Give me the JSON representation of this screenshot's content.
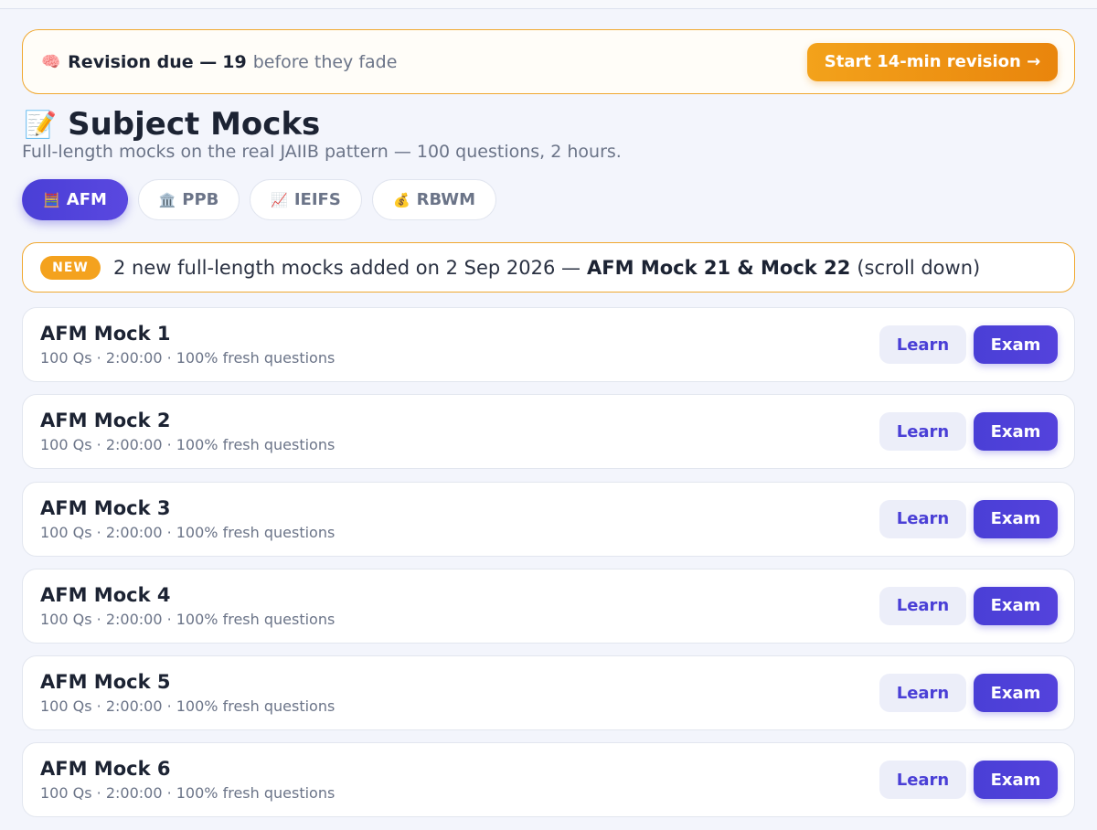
{
  "revision": {
    "label": "Revision due —",
    "count": "19",
    "suffix": "before they fade",
    "button_label": "Start 14-min revision →"
  },
  "page": {
    "title": "Subject Mocks",
    "subtitle": "Full-length mocks on the real JAIIB pattern — 100 questions, 2 hours."
  },
  "tabs": [
    {
      "label": "AFM",
      "icon": "🧮",
      "active": true
    },
    {
      "label": "PPB",
      "icon": "🏛️",
      "active": false
    },
    {
      "label": "IEIFS",
      "icon": "📈",
      "active": false
    },
    {
      "label": "RBWM",
      "icon": "💰",
      "active": false
    }
  ],
  "notice": {
    "badge": "NEW",
    "text": "2 new full-length mocks added on 2 Sep 2026 —",
    "highlight": "AFM Mock 21 & Mock 22",
    "tail": "(scroll down)"
  },
  "mocks": [
    {
      "title": "AFM Mock 1",
      "meta": "100 Qs · 2:00:00 · 100% fresh questions",
      "learn": "Learn",
      "exam": "Exam"
    },
    {
      "title": "AFM Mock 2",
      "meta": "100 Qs · 2:00:00 · 100% fresh questions",
      "learn": "Learn",
      "exam": "Exam"
    },
    {
      "title": "AFM Mock 3",
      "meta": "100 Qs · 2:00:00 · 100% fresh questions",
      "learn": "Learn",
      "exam": "Exam"
    },
    {
      "title": "AFM Mock 4",
      "meta": "100 Qs · 2:00:00 · 100% fresh questions",
      "learn": "Learn",
      "exam": "Exam"
    },
    {
      "title": "AFM Mock 5",
      "meta": "100 Qs · 2:00:00 · 100% fresh questions",
      "learn": "Learn",
      "exam": "Exam"
    },
    {
      "title": "AFM Mock 6",
      "meta": "100 Qs · 2:00:00 · 100% fresh questions",
      "learn": "Learn",
      "exam": "Exam"
    }
  ],
  "colors": {
    "accent": "#4a3fd6",
    "warning": "#f0a830",
    "text": "#1c2333",
    "muted": "#6b7488"
  },
  "icons": {
    "revision": "brain-icon",
    "title": "memo-icon"
  }
}
